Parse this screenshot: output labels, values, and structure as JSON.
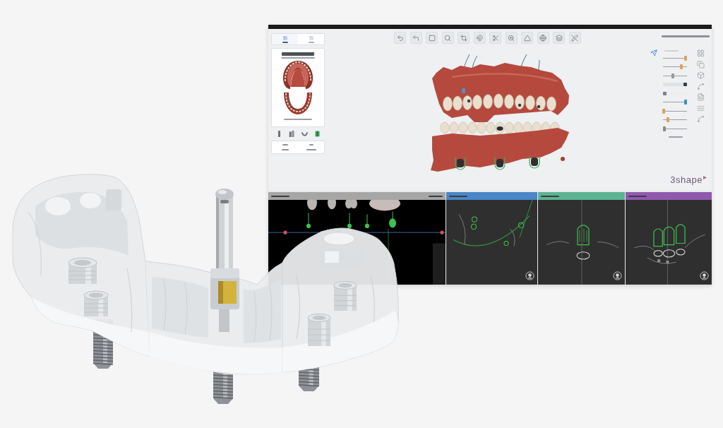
{
  "software": {
    "left_panel": {
      "tabs": [
        {
          "selected": true
        },
        {
          "selected": false
        }
      ]
    },
    "right_panel": {
      "rows": [
        {
          "kind": "slider",
          "level": 0.95,
          "color": "#d9a45e"
        },
        {
          "kind": "slider",
          "level": 0.75,
          "color": "#d9a45e"
        },
        {
          "kind": "slider",
          "level": 0.4,
          "color": "#9a9a9a"
        },
        {
          "kind": "switch",
          "on": true
        },
        {
          "kind": "switch",
          "on": false
        },
        {
          "kind": "slider",
          "level": 0.95,
          "color": "#3d8fc6"
        },
        {
          "kind": "slider",
          "level": 0.02,
          "color": "#d9a45e"
        },
        {
          "kind": "slider",
          "level": 0.2,
          "color": "#d9a45e"
        },
        {
          "kind": "slider",
          "level": 0.05,
          "color": "#8a8a8a"
        }
      ],
      "logo": "3shape"
    }
  },
  "viewports": [
    {
      "kind": "panoramic",
      "color": "#a6a6a6"
    },
    {
      "kind": "cross-section",
      "color": "#4a86c8"
    },
    {
      "kind": "cross-section",
      "color": "#5db394"
    },
    {
      "kind": "cross-section",
      "color": "#9159ae"
    }
  ]
}
